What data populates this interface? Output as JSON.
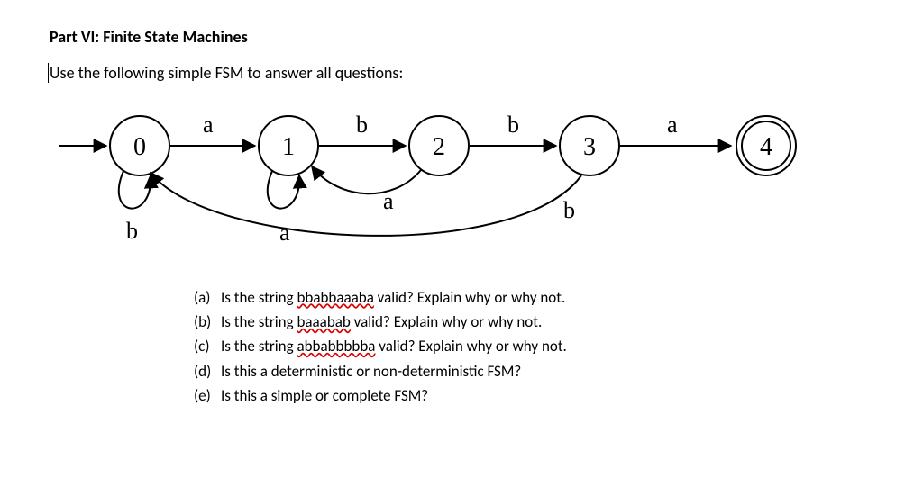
{
  "title": "Part VI: Finite State Machines",
  "prompt": "Use the following simple FSM to answer all questions:",
  "fsm": {
    "states": {
      "s0": "0",
      "s1": "1",
      "s2": "2",
      "s3": "3",
      "s4": "4"
    },
    "labels": {
      "t01": "a",
      "t12": "b",
      "t23": "b",
      "t34": "a",
      "self0": "b",
      "self1": "a",
      "t21": "a",
      "t30": "b"
    }
  },
  "questions": {
    "a": {
      "letter": "(a)",
      "pre": "Is the string ",
      "word": "bbabbaaaba",
      "post": " valid?  Explain why or why not."
    },
    "b": {
      "letter": "(b)",
      "pre": "Is the string ",
      "word": "baaabab",
      "post": " valid?  Explain why or why not."
    },
    "c": {
      "letter": "(c)",
      "pre": "Is the string ",
      "word": "abbabbbbba",
      "post": " valid?  Explain why or why not."
    },
    "d": {
      "letter": "(d)",
      "text": "Is this a deterministic or non-deterministic FSM?"
    },
    "e": {
      "letter": "(e)",
      "text": "Is this a simple or complete FSM?"
    }
  }
}
